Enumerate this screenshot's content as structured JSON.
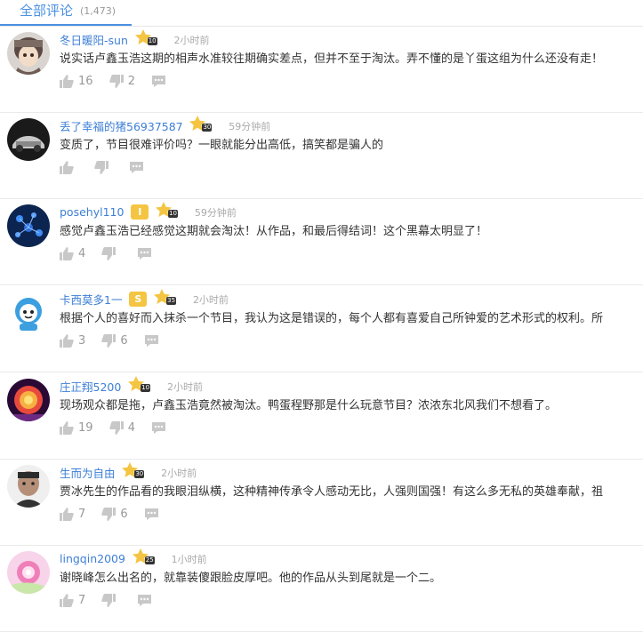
{
  "header": {
    "title": "全部评论",
    "count": "(1,473)"
  },
  "colors": {
    "accent": "#4a90e2",
    "user_link": "#3d7fd6",
    "badge": "#f4c542",
    "icon_gray": "#c8c8c8"
  },
  "comments": [
    {
      "user": "冬日暖阳-sun",
      "level": "10",
      "vip": "",
      "time": "2小时前",
      "text": "说实话卢鑫玉浩这期的相声水准较往期确实差点，但并不至于淘汰。弄不懂的是丫蛋这组为什么还没有走！",
      "likes": "16",
      "dislikes": "2"
    },
    {
      "user": "丢了幸福的猪56937587",
      "level": "30",
      "vip": "",
      "time": "59分钟前",
      "text": "变质了，节目很难评价吗？一眼就能分出高低，搞笑都是骗人的",
      "likes": "",
      "dislikes": ""
    },
    {
      "user": "posehyl110",
      "level": "10",
      "vip": "I",
      "time": "59分钟前",
      "text": "感觉卢鑫玉浩已经感觉这期就会淘汰！从作品，和最后得结词！这个黑幕太明显了！",
      "likes": "4",
      "dislikes": ""
    },
    {
      "user": "卡西莫多1一",
      "level": "35",
      "vip": "S",
      "time": "2小时前",
      "text": "根据个人的喜好而入抹杀一个节目，我认为这是错误的，每个人都有喜爱自己所钟爱的艺术形式的权利。所",
      "likes": "3",
      "dislikes": "6"
    },
    {
      "user": "庄正翔5200",
      "level": "10",
      "vip": "",
      "time": "2小时前",
      "text": "现场观众都是拖，卢鑫玉浩竟然被淘汰。鸭蛋程野那是什么玩意节目？浓浓东北风我们不想看了。",
      "likes": "19",
      "dislikes": "4"
    },
    {
      "user": "生而为自由",
      "level": "30",
      "vip": "",
      "time": "2小时前",
      "text": "贾冰先生的作品看的我眼泪纵横，这种精神传承令人感动无比，人强则国强！有这么多无私的英雄奉献，祖",
      "likes": "7",
      "dislikes": "6"
    },
    {
      "user": "lingqin2009",
      "level": "25",
      "vip": "",
      "time": "1小时前",
      "text": "谢晓峰怎么出名的，就靠装傻跟脸皮厚吧。他的作品从头到尾就是一个二。",
      "likes": "7",
      "dislikes": ""
    }
  ]
}
